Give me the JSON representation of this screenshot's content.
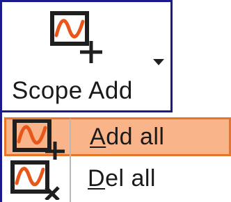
{
  "scope_button": {
    "label": "Scope Add",
    "icon": "scope-add-icon",
    "dropdown_icon": "dropdown-arrow-icon"
  },
  "menu": {
    "items": [
      {
        "mnemonic": "A",
        "rest": "dd all",
        "icon": "scope-add-icon",
        "highlighted": true
      },
      {
        "mnemonic": "D",
        "rest": "el all",
        "icon": "scope-delete-icon",
        "highlighted": false
      }
    ]
  },
  "colors": {
    "wave": "#e8561a",
    "icon_dark": "#1f1f1f",
    "hover_fill": "#f9b48a",
    "hover_border": "#e8742a",
    "focus_border": "#1a1a8c"
  }
}
